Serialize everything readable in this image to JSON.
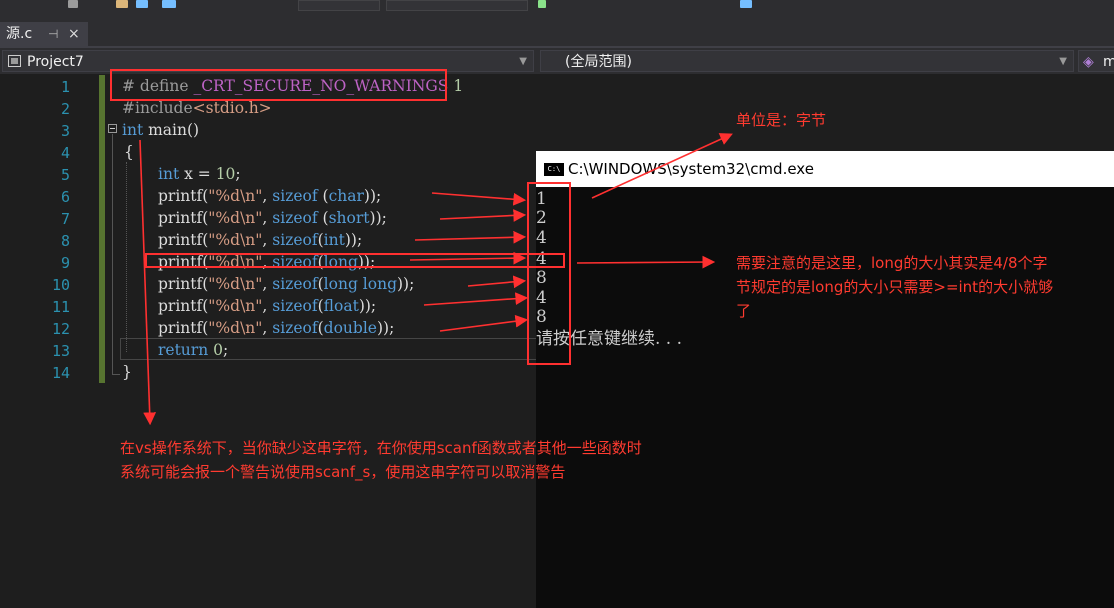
{
  "tab": {
    "label": "源.c",
    "pin": "⊣",
    "close": "×"
  },
  "nav": {
    "project": "Project7",
    "scope": "(全局范围)",
    "member": "m"
  },
  "line_numbers": [
    "1",
    "2",
    "3",
    "4",
    "5",
    "6",
    "7",
    "8",
    "9",
    "10",
    "11",
    "12",
    "13",
    "14"
  ],
  "code": {
    "l1a": "# define ",
    "l1b": "_CRT_SECURE_NO_WARNINGS",
    "l1c": " 1",
    "l2a": "#include",
    "l2b": "<stdio.h>",
    "l3a": "int",
    "l3b": " main()",
    "l4": "{",
    "l5a": "int",
    "l5b": " x = ",
    "l5c": "10",
    "l5d": ";",
    "l6a": "printf(",
    "l6b": "\"%d\\n\"",
    "l6c": ", ",
    "l6d": "sizeof",
    "l6e": " (",
    "l6f": "char",
    "l6g": "));",
    "l7a": "printf(",
    "l7b": "\"%d\\n\"",
    "l7c": ", ",
    "l7d": "sizeof",
    "l7e": " (",
    "l7f": "short",
    "l7g": "));",
    "l8a": "printf(",
    "l8b": "\"%d\\n\"",
    "l8c": ", ",
    "l8d": "sizeof",
    "l8e": "(",
    "l8f": "int",
    "l8g": "));",
    "l9a": "printf(",
    "l9b": "\"%d\\n\"",
    "l9c": ", ",
    "l9d": "sizeof",
    "l9e": "(",
    "l9f": "long",
    "l9g": "));",
    "l10a": "printf(",
    "l10b": "\"%d\\n\"",
    "l10c": ", ",
    "l10d": "sizeof",
    "l10e": "(",
    "l10f": "long long",
    "l10g": "));",
    "l11a": "printf(",
    "l11b": "\"%d\\n\"",
    "l11c": ", ",
    "l11d": "sizeof",
    "l11e": "(",
    "l11f": "float",
    "l11g": "));",
    "l12a": "printf(",
    "l12b": "\"%d\\n\"",
    "l12c": ", ",
    "l12d": "sizeof",
    "l12e": "(",
    "l12f": "double",
    "l12g": "));",
    "l13a": "return",
    "l13b": " ",
    "l13c": "0",
    "l13d": ";",
    "l14": "}"
  },
  "cmd": {
    "title": "C:\\WINDOWS\\system32\\cmd.exe",
    "icon_text": "C:\\",
    "output": [
      "1",
      "2",
      "4",
      "4",
      "8",
      "4",
      "8"
    ],
    "prompt": "请按任意键继续. . ."
  },
  "annotations": {
    "unit": "单位是：字节",
    "long_note_1": "需要注意的是这里，long的大小其实是4/8个字",
    "long_note_2": "节规定的是long的大小只需要>=int的大小就够",
    "long_note_3": "了",
    "define_note_1": "在vs操作系统下，当你缺少这串字符，在你使用scanf函数或者其他一些函数时",
    "define_note_2": "系统可能会报一个警告说使用scanf_s，使用这串字符可以取消警告"
  },
  "colors": {
    "annotation": "#ff3b30",
    "keyword": "#569cd6",
    "macro": "#bd63c5",
    "string": "#d69d85",
    "number": "#b5cea8",
    "line_number": "#2b91af"
  }
}
